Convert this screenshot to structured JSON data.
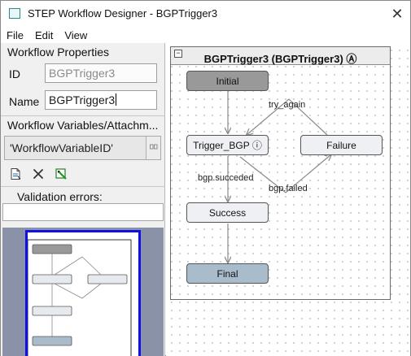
{
  "window": {
    "title": "STEP Workflow Designer - BGPTrigger3"
  },
  "menu": [
    "File",
    "Edit",
    "View"
  ],
  "properties": {
    "heading": "Workflow Properties",
    "id_label": "ID",
    "id_value": "BGPTrigger3",
    "name_label": "Name",
    "name_value": "BGPTrigger3"
  },
  "variables": {
    "heading": "Workflow Variables/Attachm...",
    "item": "'WorkflowVariableID'",
    "button_icon": "edit-icon"
  },
  "toolbar": [
    "add-variable-icon",
    "delete-variable-icon",
    "edit-variable-icon"
  ],
  "validation": {
    "heading": "Validation errors:",
    "value": ""
  },
  "workflow": {
    "title": "BGPTrigger3 (BGPTrigger3) Ⓐ",
    "collapse": "−",
    "nodes": {
      "initial": "Initial",
      "trigger": "Trigger_BGP ⓘ",
      "failure": "Failure",
      "success": "Success",
      "final": "Final"
    },
    "edges": {
      "try_again": "try_again",
      "succeeded": "bgp.succeded",
      "failed": "bgp.failed"
    }
  },
  "colors": {
    "initial": "#999999",
    "state": "#eef0f4",
    "final": "#a9bccc",
    "minimap_frame": "#1010e0",
    "minimap_bg": "#8a92a8"
  }
}
